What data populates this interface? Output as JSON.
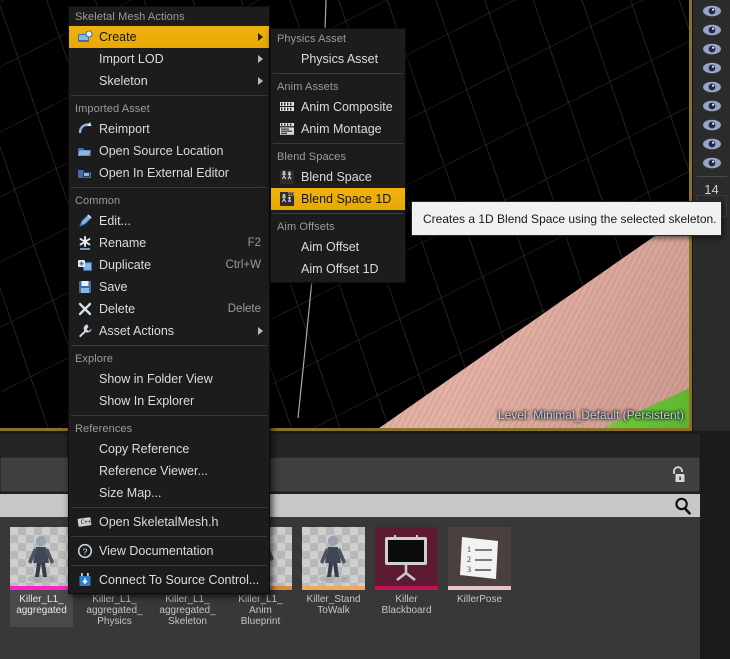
{
  "viewport": {
    "level_prefix": "Level:",
    "level_name": "Minimal_Default (Persistent)"
  },
  "right_rail": {
    "eye_icon": "eye-icon",
    "count": "14"
  },
  "lower_panel": {
    "lock_icon": "lock-icon",
    "search_icon": "search-icon",
    "search_value": "",
    "search_placeholder": ""
  },
  "assets": [
    {
      "label": "Killer_L1_\naggregated",
      "strip": "#ff22c8",
      "selected": true,
      "kind": "skeletal-mesh"
    },
    {
      "label": "Killer_L1_\naggregated_\nPhysics",
      "strip": "#e08c3a",
      "selected": false,
      "kind": "physics-asset"
    },
    {
      "label": "Killer_L1_\naggregated_\nSkeleton",
      "strip": "#3fb8c8",
      "selected": false,
      "kind": "skeleton"
    },
    {
      "label": "Killer_L1_\nAnim\nBlueprint",
      "strip": "#e08c3a",
      "selected": false,
      "kind": "anim-blueprint"
    },
    {
      "label": "Killer_Stand\nToWalk",
      "strip": "#f0a85c",
      "selected": false,
      "kind": "animation"
    },
    {
      "label": "Killer\nBlackboard",
      "strip": "#c21254",
      "selected": false,
      "kind": "blackboard"
    },
    {
      "label": "KillerPose",
      "strip": "#e8c4c4",
      "selected": false,
      "kind": "pose-asset"
    }
  ],
  "context_menu": {
    "sections": [
      {
        "header": "Skeletal Mesh Actions",
        "items": [
          {
            "label": "Create",
            "icon": "create-icon",
            "submenu": true,
            "highlighted": true,
            "accel": ""
          },
          {
            "label": "Import LOD",
            "icon": "",
            "submenu": true,
            "highlighted": false,
            "accel": ""
          },
          {
            "label": "Skeleton",
            "icon": "",
            "submenu": true,
            "highlighted": false,
            "accel": ""
          }
        ]
      },
      {
        "header": "Imported Asset",
        "items": [
          {
            "label": "Reimport",
            "icon": "reimport-icon",
            "submenu": false,
            "highlighted": false,
            "accel": ""
          },
          {
            "label": "Open Source Location",
            "icon": "folder-open-icon",
            "submenu": false,
            "highlighted": false,
            "accel": ""
          },
          {
            "label": "Open In External Editor",
            "icon": "external-editor-icon",
            "submenu": false,
            "highlighted": false,
            "accel": ""
          }
        ]
      },
      {
        "header": "Common",
        "items": [
          {
            "label": "Edit...",
            "icon": "edit-icon",
            "submenu": false,
            "highlighted": false,
            "accel": ""
          },
          {
            "label": "Rename",
            "icon": "rename-icon",
            "submenu": false,
            "highlighted": false,
            "accel": "F2"
          },
          {
            "label": "Duplicate",
            "icon": "duplicate-icon",
            "submenu": false,
            "highlighted": false,
            "accel": "Ctrl+W"
          },
          {
            "label": "Save",
            "icon": "save-icon",
            "submenu": false,
            "highlighted": false,
            "accel": ""
          },
          {
            "label": "Delete",
            "icon": "delete-icon",
            "submenu": false,
            "highlighted": false,
            "accel": "Delete"
          },
          {
            "label": "Asset Actions",
            "icon": "wrench-icon",
            "submenu": true,
            "highlighted": false,
            "accel": ""
          }
        ]
      },
      {
        "header": "Explore",
        "items": [
          {
            "label": "Show in Folder View",
            "icon": "",
            "submenu": false,
            "highlighted": false,
            "accel": ""
          },
          {
            "label": "Show In Explorer",
            "icon": "",
            "submenu": false,
            "highlighted": false,
            "accel": ""
          }
        ]
      },
      {
        "header": "References",
        "items": [
          {
            "label": "Copy Reference",
            "icon": "",
            "submenu": false,
            "highlighted": false,
            "accel": ""
          },
          {
            "label": "Reference Viewer...",
            "icon": "",
            "submenu": false,
            "highlighted": false,
            "accel": ""
          },
          {
            "label": "Size Map...",
            "icon": "",
            "submenu": false,
            "highlighted": false,
            "accel": ""
          }
        ]
      },
      {
        "header": "",
        "items": [
          {
            "label": "Open SkeletalMesh.h",
            "icon": "code-file-icon",
            "submenu": false,
            "highlighted": false,
            "accel": ""
          }
        ]
      },
      {
        "header": "",
        "items": [
          {
            "label": "View Documentation",
            "icon": "help-icon",
            "submenu": false,
            "highlighted": false,
            "accel": ""
          }
        ]
      },
      {
        "header": "",
        "items": [
          {
            "label": "Connect To Source Control...",
            "icon": "source-control-icon",
            "submenu": false,
            "highlighted": false,
            "accel": ""
          }
        ]
      }
    ]
  },
  "submenu": {
    "sections": [
      {
        "header": "Physics Asset",
        "items": [
          {
            "label": "Physics Asset",
            "icon": "",
            "highlighted": false
          }
        ]
      },
      {
        "header": "Anim Assets",
        "items": [
          {
            "label": "Anim Composite",
            "icon": "anim-composite-icon",
            "highlighted": false
          },
          {
            "label": "Anim Montage",
            "icon": "anim-montage-icon",
            "highlighted": false
          }
        ]
      },
      {
        "header": "Blend Spaces",
        "items": [
          {
            "label": "Blend Space",
            "icon": "blend-space-icon",
            "highlighted": false
          },
          {
            "label": "Blend Space 1D",
            "icon": "blend-space-1d-icon",
            "highlighted": true
          }
        ]
      },
      {
        "header": "Aim Offsets",
        "items": [
          {
            "label": "Aim Offset",
            "icon": "",
            "highlighted": false
          },
          {
            "label": "Aim Offset 1D",
            "icon": "",
            "highlighted": false
          }
        ]
      }
    ]
  },
  "tooltip": {
    "text": "Creates a 1D Blend Space using the selected skeleton."
  },
  "colors": {
    "highlight": "#eeb211",
    "menu_bg": "#1c1c1c",
    "panel_bg": "#383838",
    "viewport_border": "#8a7228"
  }
}
